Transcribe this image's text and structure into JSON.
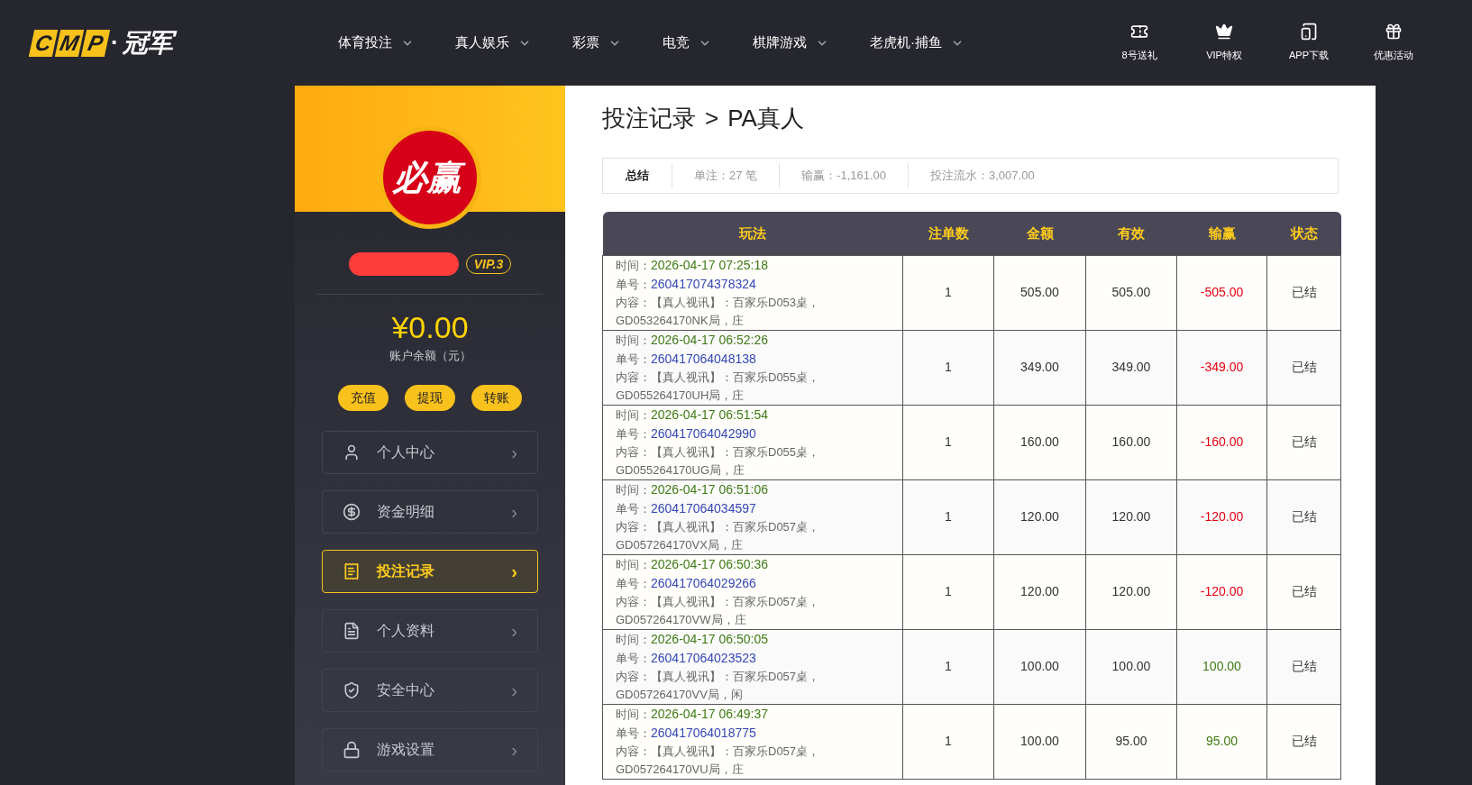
{
  "logo": {
    "letters": [
      "C",
      "M",
      "P"
    ],
    "dot": "·",
    "name": "冠军"
  },
  "nav": [
    {
      "label": "体育投注"
    },
    {
      "label": "真人娱乐"
    },
    {
      "label": "彩票"
    },
    {
      "label": "电竞"
    },
    {
      "label": "棋牌游戏"
    },
    {
      "label": "老虎机·捕鱼"
    }
  ],
  "quick_links": [
    {
      "kind": "ticket",
      "label": "8号送礼"
    },
    {
      "kind": "crown",
      "label": "VIP特权"
    },
    {
      "kind": "tablet",
      "label": "APP下载"
    },
    {
      "kind": "gift",
      "label": "优惠活动"
    }
  ],
  "profile": {
    "avatar_text": "必赢",
    "vip": "VIP.3",
    "balance": "¥0.00",
    "balance_label": "账户余额（元）",
    "actions": [
      "充值",
      "提现",
      "转账"
    ]
  },
  "menu": [
    {
      "kind": "user",
      "label": "个人中心",
      "selected": false,
      "arrow": "›"
    },
    {
      "kind": "money",
      "label": "资金明细",
      "selected": false,
      "arrow": "›"
    },
    {
      "kind": "record",
      "label": "投注记录",
      "selected": true,
      "arrow": "›"
    },
    {
      "kind": "document",
      "label": "个人资料",
      "selected": false,
      "arrow": "›"
    },
    {
      "kind": "shield",
      "label": "安全中心",
      "selected": false,
      "arrow": "›"
    },
    {
      "kind": "lock",
      "label": "游戏设置",
      "selected": false,
      "arrow": "›"
    }
  ],
  "breadcrumb": {
    "parent": "投注记录",
    "separator": ">",
    "current": "PA真人"
  },
  "summary": [
    {
      "label": "总结"
    },
    {
      "label": "单注：27 笔"
    },
    {
      "label": "输赢：-1,161.00"
    },
    {
      "label": "投注流水：3,007.00"
    }
  ],
  "table": {
    "columns": [
      "玩法",
      "注单数",
      "金额",
      "有效",
      "输赢",
      "状态"
    ],
    "rows": [
      {
        "time_label": "时间：",
        "time": "2026-04-17 07:25:18",
        "no_label": "单号：",
        "no": "260417074378324",
        "content": "内容：【真人视讯】：百家乐D053桌，GD053264170NK局，庄",
        "count": "1",
        "amount": "505.00",
        "valid": "505.00",
        "result": "-505.00",
        "kind": "loss",
        "status": "已结"
      },
      {
        "time_label": "时间：",
        "time": "2026-04-17 06:52:26",
        "no_label": "单号：",
        "no": "260417064048138",
        "content": "内容：【真人视讯】：百家乐D055桌，GD055264170UH局，庄",
        "count": "1",
        "amount": "349.00",
        "valid": "349.00",
        "result": "-349.00",
        "kind": "loss",
        "status": "已结"
      },
      {
        "time_label": "时间：",
        "time": "2026-04-17 06:51:54",
        "no_label": "单号：",
        "no": "260417064042990",
        "content": "内容：【真人视讯】：百家乐D055桌，GD055264170UG局，庄",
        "count": "1",
        "amount": "160.00",
        "valid": "160.00",
        "result": "-160.00",
        "kind": "loss",
        "status": "已结"
      },
      {
        "time_label": "时间：",
        "time": "2026-04-17 06:51:06",
        "no_label": "单号：",
        "no": "260417064034597",
        "content": "内容：【真人视讯】：百家乐D057桌，GD057264170VX局，庄",
        "count": "1",
        "amount": "120.00",
        "valid": "120.00",
        "result": "-120.00",
        "kind": "loss",
        "status": "已结"
      },
      {
        "time_label": "时间：",
        "time": "2026-04-17 06:50:36",
        "no_label": "单号：",
        "no": "260417064029266",
        "content": "内容：【真人视讯】：百家乐D057桌，GD057264170VW局，庄",
        "count": "1",
        "amount": "120.00",
        "valid": "120.00",
        "result": "-120.00",
        "kind": "loss",
        "status": "已结"
      },
      {
        "time_label": "时间：",
        "time": "2026-04-17 06:50:05",
        "no_label": "单号：",
        "no": "260417064023523",
        "content": "内容：【真人视讯】：百家乐D057桌，GD057264170VV局，闲",
        "count": "1",
        "amount": "100.00",
        "valid": "100.00",
        "result": "100.00",
        "kind": "win",
        "status": "已结"
      },
      {
        "time_label": "时间：",
        "time": "2026-04-17 06:49:37",
        "no_label": "单号：",
        "no": "260417064018775",
        "content": "内容：【真人视讯】：百家乐D057桌，GD057264170VU局，庄",
        "count": "1",
        "amount": "100.00",
        "valid": "95.00",
        "result": "95.00",
        "kind": "win",
        "status": "已结"
      }
    ]
  }
}
